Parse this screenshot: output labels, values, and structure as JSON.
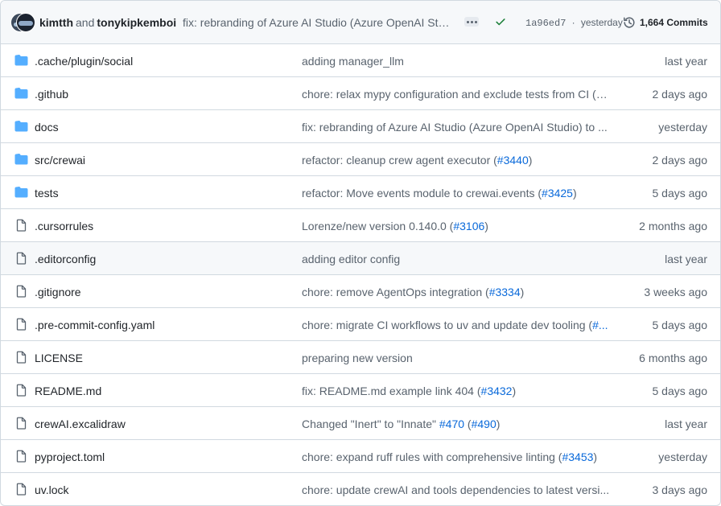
{
  "latest_commit": {
    "author1": "kimtth",
    "conjunction": "and",
    "author2": "tonykipkemboi",
    "message": "fix: rebranding of Azure AI Studio (Azure OpenAI Studio) to Azure AI Foundry",
    "sha": "1a96ed7",
    "separator": "·",
    "when": "yesterday",
    "commits_label": "1,664 Commits"
  },
  "colors": {
    "folder": "#54aeff",
    "file": "#59636e",
    "link": "#0969da",
    "success": "#1a7f37"
  },
  "files": [
    {
      "type": "folder",
      "name": ".cache/plugin/social",
      "message": "adding manager_llm",
      "ref": "",
      "tail": "",
      "time": "last year"
    },
    {
      "type": "folder",
      "name": ".github",
      "message": "chore: relax mypy configuration and exclude tests from CI (",
      "ref": "#...",
      "tail": "",
      "time": "2 days ago"
    },
    {
      "type": "folder",
      "name": "docs",
      "message": "fix: rebranding of Azure AI Studio (Azure OpenAI Studio) to ...",
      "ref": "",
      "tail": "",
      "time": "yesterday"
    },
    {
      "type": "folder",
      "name": "src/crewai",
      "message": "refactor: cleanup crew agent executor (",
      "ref": "#3440",
      "tail": ")",
      "time": "2 days ago"
    },
    {
      "type": "folder",
      "name": "tests",
      "message": "refactor: Move events module to crewai.events (",
      "ref": "#3425",
      "tail": ")",
      "time": "5 days ago"
    },
    {
      "type": "file",
      "name": ".cursorrules",
      "message": "Lorenze/new version 0.140.0 (",
      "ref": "#3106",
      "tail": ")",
      "time": "2 months ago"
    },
    {
      "type": "file",
      "name": ".editorconfig",
      "message": "adding editor config",
      "ref": "",
      "tail": "",
      "time": "last year"
    },
    {
      "type": "file",
      "name": ".gitignore",
      "message": "chore: remove AgentOps integration (",
      "ref": "#3334",
      "tail": ")",
      "time": "3 weeks ago"
    },
    {
      "type": "file",
      "name": ".pre-commit-config.yaml",
      "message": "chore: migrate CI workflows to uv and update dev tooling (",
      "ref": "#...",
      "tail": "",
      "time": "5 days ago"
    },
    {
      "type": "file",
      "name": "LICENSE",
      "message": "preparing new version",
      "ref": "",
      "tail": "",
      "time": "6 months ago"
    },
    {
      "type": "file",
      "name": "README.md",
      "message": "fix: README.md example link 404 (",
      "ref": "#3432",
      "tail": ")",
      "time": "5 days ago"
    },
    {
      "type": "file",
      "name": "crewAI.excalidraw",
      "message": "Changed \"Inert\" to \"Innate\" ",
      "ref": "#470",
      "ref2_pre": " (",
      "ref2": "#490",
      "tail": ")",
      "time": "last year"
    },
    {
      "type": "file",
      "name": "pyproject.toml",
      "message": "chore: expand ruff rules with comprehensive linting (",
      "ref": "#3453",
      "tail": ")",
      "time": "yesterday"
    },
    {
      "type": "file",
      "name": "uv.lock",
      "message": "chore: update crewAI and tools dependencies to latest versi...",
      "ref": "",
      "tail": "",
      "time": "3 days ago"
    }
  ]
}
